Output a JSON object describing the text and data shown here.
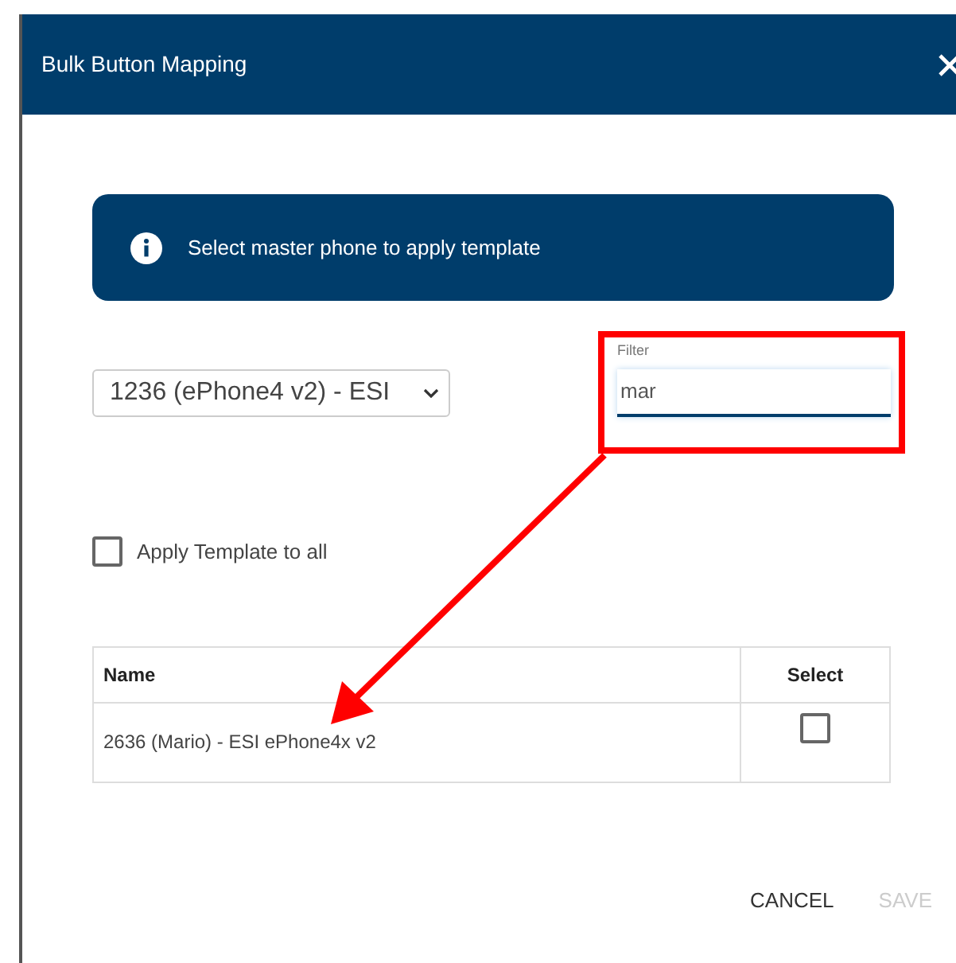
{
  "dialog": {
    "title": "Bulk Button Mapping"
  },
  "banner": {
    "text": "Select master phone to apply template"
  },
  "master_phone": {
    "value": "1236 (ePhone4 v2) - ESI"
  },
  "filter": {
    "label": "Filter",
    "value": "mar"
  },
  "apply_all": {
    "label": "Apply Template to all",
    "checked": false
  },
  "table": {
    "columns": [
      "Name",
      "Select"
    ],
    "rows": [
      {
        "name": "2636 (Mario) - ESI ePhone4x v2",
        "checked": false
      }
    ]
  },
  "buttons": [
    {
      "label": "CANCEL",
      "disabled": false
    },
    {
      "label": "SAVE",
      "disabled": true
    }
  ]
}
